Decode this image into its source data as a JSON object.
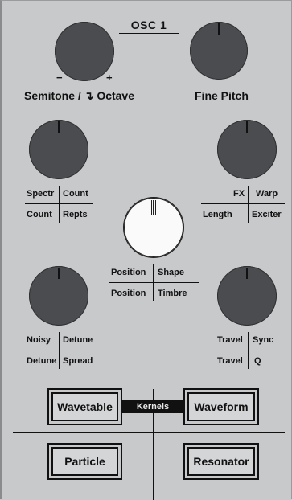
{
  "header": {
    "title": "OSC 1"
  },
  "semitone": {
    "minus": "−",
    "plus": "+",
    "label_pre": "Semitone /",
    "arrow": "↴",
    "label_post": "Octave"
  },
  "fine_pitch": {
    "label": "Fine Pitch"
  },
  "left_top": {
    "top_left": "Spectr",
    "top_right": "Count",
    "bottom_left": "Count",
    "bottom_right": "Repts"
  },
  "right_top": {
    "top_left": "FX",
    "top_right": "Warp",
    "bottom_left": "Length",
    "bottom_right": "Exciter"
  },
  "center": {
    "top_left": "Position",
    "top_right": "Shape",
    "bottom_left": "Position",
    "bottom_right": "Timbre"
  },
  "left_bottom": {
    "top_left": "Noisy",
    "top_right": "Detune",
    "bottom_left": "Detune",
    "bottom_right": "Spread"
  },
  "right_bottom": {
    "top_left": "Travel",
    "top_right": "Sync",
    "bottom_left": "Travel",
    "bottom_right": "Q"
  },
  "modes": {
    "kernels_label": "Kernels",
    "wavetable": "Wavetable",
    "waveform": "Waveform",
    "particle": "Particle",
    "resonator": "Resonator"
  },
  "colors": {
    "panel": "#c8c9cb",
    "knob": "#4b4c4f",
    "knob_active": "#fafafa",
    "ink": "#111111"
  }
}
